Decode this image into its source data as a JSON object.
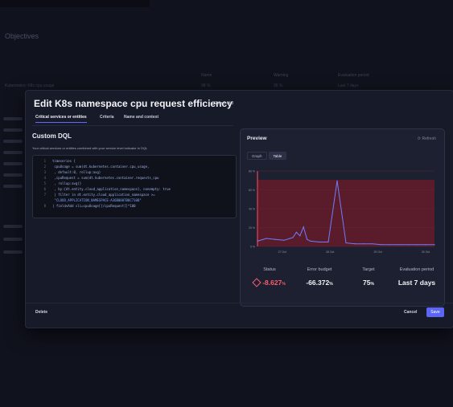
{
  "background": {
    "page_title": "Objectives",
    "headers": [
      "Name",
      "Warning",
      "Evaluation period"
    ],
    "row": [
      "Kubernetes: K8s cpu usage",
      "98 %",
      "95 %",
      "Last 7 days"
    ]
  },
  "modal": {
    "title": "Edit K8s namespace cpu request efficiency",
    "step": "Step 1 of 3",
    "tabs": [
      {
        "label": "Critical services or entities",
        "active": true
      },
      {
        "label": "Criteria",
        "active": false
      },
      {
        "label": "Name and context",
        "active": false
      }
    ],
    "section_title": "Custom DQL",
    "description": "Your critical services or entities combined with your service level indicator in DQL",
    "code_lines": [
      {
        "n": "1",
        "text": "timeseries {"
      },
      {
        "n": "2",
        "text": "  cpuUsage = sum(dt.kubernetes.container.cpu_usage,"
      },
      {
        "n": "3",
        "text": "  , default:0, rollup:avg)"
      },
      {
        "n": "4",
        "text": "  ,cpuRequest = sum(dt.kubernetes.container.requests_cpu"
      },
      {
        "n": "5",
        "text": "  , rollup:avg)}"
      },
      {
        "n": "6",
        "text": "  , by:{dt.entity.cloud_application_namespace}, nonempty: true"
      },
      {
        "n": "7",
        "text": "  | filter in dt.entity.cloud_application_namespace >="
      },
      {
        "n": "",
        "text": "  \"CLOUD_APPLICATION_NAMESPACE-A36B0887B8C710B\""
      },
      {
        "n": "8",
        "text": "| fieldsAdd sli=cpuUsage[]/cpuRequest[]*100"
      }
    ],
    "delete_label": "Delete",
    "cancel_label": "Cancel",
    "save_label": "Save"
  },
  "preview": {
    "title": "Preview",
    "refresh_label": "Refresh",
    "toggle": [
      {
        "label": "Graph",
        "active": false
      },
      {
        "label": "Table",
        "active": true
      }
    ],
    "metrics": [
      {
        "label": "Status",
        "value": "-8.627",
        "unit": "%"
      },
      {
        "label": "Error budget",
        "value": "-66.372",
        "unit": "%"
      },
      {
        "label": "Target",
        "value": "75",
        "unit": "%"
      },
      {
        "label": "Evaluation period",
        "value": "Last 7 days",
        "unit": ""
      }
    ],
    "colors": {
      "bad": "#ff5d6a",
      "line": "#6f7cff",
      "target_band": "#5a1c2a",
      "accent": "#5b66f6"
    }
  },
  "chart_data": {
    "type": "line",
    "title": "",
    "xlabel": "",
    "ylabel": "",
    "y_ticks": [
      "80 %",
      "60 %",
      "40 %",
      "20 %",
      "0 %"
    ],
    "x_ticks": [
      "27 Oct",
      "28 Oct",
      "29 Oct",
      "30 Oct"
    ],
    "x": [
      0,
      0.05,
      0.1,
      0.15,
      0.2,
      0.22,
      0.24,
      0.26,
      0.28,
      0.3,
      0.35,
      0.4,
      0.45,
      0.5,
      0.55,
      0.6,
      0.65,
      0.7,
      0.75,
      0.8,
      0.85,
      0.9,
      0.95,
      1.0
    ],
    "series": [
      {
        "values": [
          6,
          9,
          8,
          7,
          10,
          16,
          12,
          22,
          8,
          6,
          5,
          5,
          74,
          4,
          3,
          3,
          3,
          2,
          2,
          2,
          2,
          2,
          2,
          2
        ]
      }
    ],
    "ylim": [
      0,
      85
    ],
    "target_band": [
      0,
      75
    ],
    "grid": true
  }
}
